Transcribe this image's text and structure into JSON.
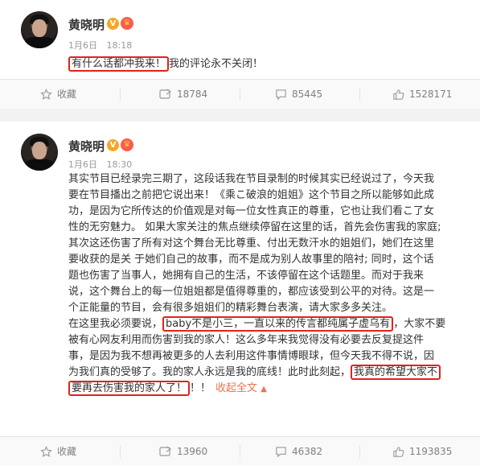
{
  "posts": [
    {
      "username": "黄晓明",
      "date": "1月6日",
      "time": "18:18",
      "highlight": "有什么话都冲我来！",
      "rest": "我的评论永不关闭！",
      "actions": {
        "favorite": "收藏",
        "share": "18784",
        "comment": "85445",
        "like": "1528171"
      }
    },
    {
      "username": "黄晓明",
      "date": "1月6日",
      "time": "18:30",
      "lines": [
        "其实节目已经录完三期了，这段话我在节目录制的时候其实已经说过了，今天我",
        "要在节目播出之前把它说出来！《乘こ破浪的姐姐》这个节目之所以能够如此成",
        "功，是因为它所传达的价值观是对每一位女性真正的尊重，它也让我们看こ了女",
        "性的无穷魅力。 如果大家关注的焦点继续停留在这里的话，首先会伤害我的家庭;",
        "其次这还伤害了所有对这个舞台无比尊重、付出无数汗水的姐姐们，她们在这里",
        "要收获的是关 于她们自己的故事，而不是成为别人故事里的陪衬; 同时，这个话",
        "题也伤害了当事人，她拥有自己的生活，不该停留在这个话题里。而对于我来",
        "说，这个舞台上的每一位姐姐都是值得尊重的，都应该受到公平的对待。这是一",
        "个正能量的节目，会有很多姐姐们的精彩舞台表演，请大家多多关注。"
      ],
      "line10_pre": "在这里我必须要说，",
      "line10_hl": "baby不是小三，一直以来的传言都纯属子虚乌有",
      "line10_post": "，大家不要",
      "line11": "被有心网友利用而伤害到我的家人！这么多年来我觉得没有必要去反复提这件",
      "line12": "事，是因为我不想再被更多的人去利用这件事情博眼球，但今天我不得不说，因",
      "line13_pre": "为我们真的受够了。我的家人永远是我的底线！此时此刻起，",
      "line13_hl": "我真的希望大家不",
      "line14_hl": "要再去伤害我的家人了！",
      "line14_post": "！！",
      "collapse": "收起全文",
      "collapse_caret": "▲",
      "actions": {
        "favorite": "收藏",
        "share": "13960",
        "comment": "46382",
        "like": "1193835"
      }
    }
  ],
  "icons": {
    "verified": "V",
    "verified_color": "#f5a623",
    "crown": "♛",
    "crown_color": "#ff5a4f"
  },
  "colors": {
    "highlight_border": "#e2231a",
    "link": "#eb7350"
  }
}
